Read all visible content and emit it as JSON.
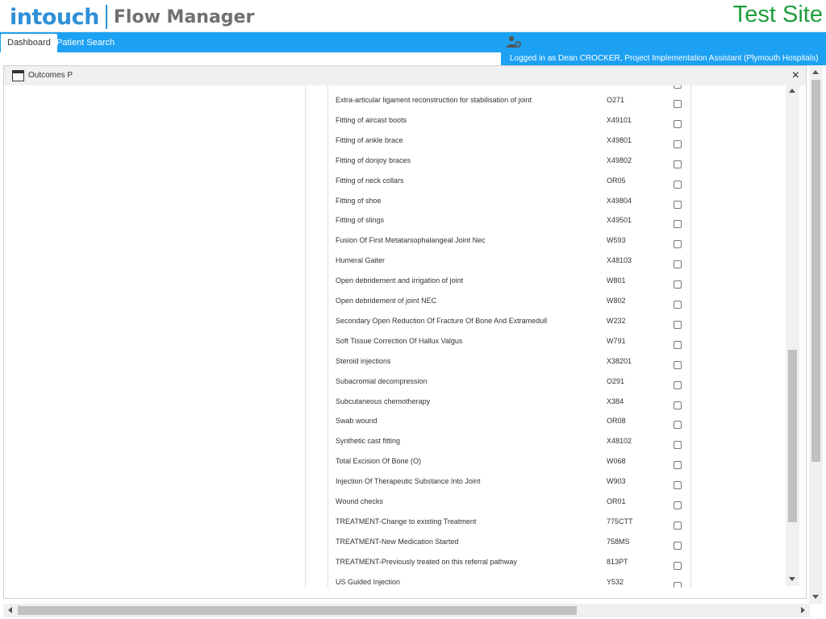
{
  "header": {
    "logo_primary": "intouch",
    "logo_secondary": "Flow Manager",
    "site_label": "Test Site"
  },
  "nav": {
    "tabs": [
      {
        "label": "Dashboard",
        "active": true
      },
      {
        "label": "Patient Search",
        "active": false
      }
    ],
    "logged_in_text": "Logged in as Dean CROCKER, Project Implementation Assistant (Plymouth Hospitals)",
    "user_icon": "user-settings-icon"
  },
  "colors": {
    "brand_blue": "#1da1f2",
    "site_green": "#1e9e3c",
    "logo_blue": "#2f8fd8"
  },
  "dialog": {
    "title": "Outcomes P",
    "close_label": "×",
    "items": [
      {
        "name": "Extra-articular ligament reconstruction for stabilisation of joint",
        "code": "O271",
        "checked": false
      },
      {
        "name": "Fitting of aircast boots",
        "code": "X49101",
        "checked": false
      },
      {
        "name": "Fitting of ankle brace",
        "code": "X49801",
        "checked": false
      },
      {
        "name": "Fitting of donjoy braces",
        "code": "X49802",
        "checked": false
      },
      {
        "name": "Fitting of neck collars",
        "code": "OR05",
        "checked": false
      },
      {
        "name": "Fitting of shoe",
        "code": "X49804",
        "checked": false
      },
      {
        "name": "Fitting of slings",
        "code": "X49501",
        "checked": false
      },
      {
        "name": "Fusion Of First Metatarsophalangeal Joint Nec",
        "code": "W593",
        "checked": false
      },
      {
        "name": "Humeral Gaiter",
        "code": "X48103",
        "checked": false
      },
      {
        "name": "Open debridement and irrigation of joint",
        "code": "W801",
        "checked": false
      },
      {
        "name": "Open debridement of joint NEC",
        "code": "W802",
        "checked": false
      },
      {
        "name": "Secondary Open Reduction Of Fracture Of Bone And Extramedull",
        "code": "W232",
        "checked": false
      },
      {
        "name": "Soft Tissue Correction Of Hallux Valgus",
        "code": "W791",
        "checked": false
      },
      {
        "name": "Steroid injections",
        "code": "X38201",
        "checked": false
      },
      {
        "name": "Subacromial decompression",
        "code": "O291",
        "checked": false
      },
      {
        "name": "Subcutaneous chemotherapy",
        "code": "X384",
        "checked": false
      },
      {
        "name": "Swab wound",
        "code": "OR08",
        "checked": false
      },
      {
        "name": "Synthetic cast fitting",
        "code": "X48102",
        "checked": false
      },
      {
        "name": "Total Excision Of Bone (O)",
        "code": "W068",
        "checked": false
      },
      {
        "name": "Injection Of Therapeutic Substance Into Joint",
        "code": "W903",
        "checked": false
      },
      {
        "name": "Wound checks",
        "code": "OR01",
        "checked": false
      },
      {
        "name": "TREATMENT-Change to existing Treatment",
        "code": "775CTT",
        "checked": false
      },
      {
        "name": "TREATMENT-New Medication Started",
        "code": "758MS",
        "checked": false
      },
      {
        "name": "TREATMENT-Previously treated on this referral pathway",
        "code": "813PT",
        "checked": false
      },
      {
        "name": "US Guided Injection",
        "code": "Y532",
        "checked": false
      }
    ]
  }
}
